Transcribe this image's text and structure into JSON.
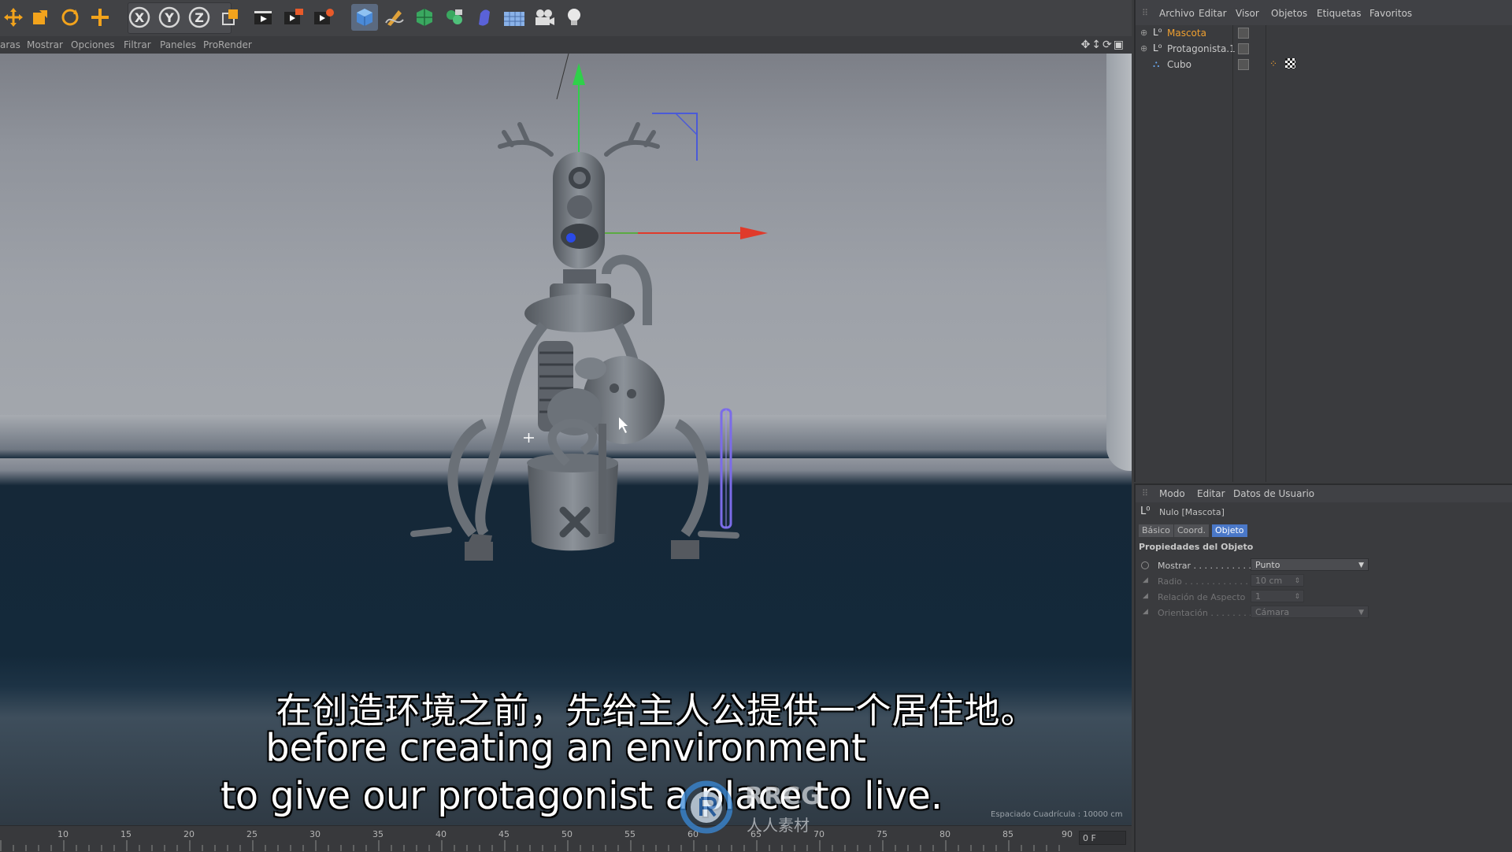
{
  "toolbar": {
    "icons": [
      "move-icon",
      "scale-icon",
      "rotate-icon",
      "create-icon",
      "x-axis-icon",
      "y-axis-icon",
      "z-axis-icon",
      "world-coordinate-icon",
      "render-view-icon",
      "render-picture-viewer-icon",
      "render-settings-icon",
      "cube-icon",
      "pen-icon",
      "subdivision-icon",
      "array-icon",
      "deformer-icon",
      "floor-icon",
      "camera-icon",
      "light-icon"
    ],
    "axis_labels": {
      "x": "X",
      "y": "Y",
      "z": "Z"
    }
  },
  "viewport_menu": [
    "aras",
    "Mostrar",
    "Opciones",
    "Filtrar",
    "Paneles",
    "ProRender"
  ],
  "viewport": {
    "grid_spacing_text": "Espaciado Cuadrícula : 10000 cm"
  },
  "object_manager": {
    "menu": [
      "Archivo",
      "Editar",
      "Visor",
      "Objetos",
      "Etiquetas",
      "Favoritos"
    ],
    "objects": [
      {
        "name": "Mascota",
        "selected": true
      },
      {
        "name": "Protagonista.1",
        "selected": false
      },
      {
        "name": "Cubo",
        "selected": false
      }
    ]
  },
  "attribute_manager": {
    "menu": [
      "Modo",
      "Editar",
      "Datos de Usuario"
    ],
    "object_title": "Nulo [Mascota]",
    "tabs": [
      "Básico",
      "Coord.",
      "Objeto"
    ],
    "active_tab": "Objeto",
    "section_title": "Propiedades del Objeto",
    "properties": [
      {
        "label": "Mostrar . . . . . . . . . . .",
        "value": "Punto",
        "enabled": true
      },
      {
        "label": "Radio . . . . . . . . . . . . .",
        "value": "10 cm",
        "enabled": false
      },
      {
        "label": "Relación de Aspecto",
        "value": "1",
        "enabled": false
      },
      {
        "label": "Orientación . . . . . . . .",
        "value": "Cámara",
        "enabled": false
      }
    ]
  },
  "timeline": {
    "ticks": [
      "10",
      "15",
      "20",
      "25",
      "30",
      "35",
      "40",
      "45",
      "50",
      "55",
      "60",
      "65",
      "70",
      "75",
      "80",
      "85",
      "90"
    ],
    "current_frame": "0 F"
  },
  "subtitles": {
    "chinese": "在创造环境之前，先给主人公提供一个居住地。",
    "english_line1": "before creating an environment",
    "english_line2": "to give our protagonist a place to live."
  },
  "watermark": {
    "text": "RRCG",
    "subtext": "人人素材"
  },
  "colors": {
    "accent_selected": "#f0a030",
    "active_tab": "#4a78c8",
    "x_axis": "#e03a2a",
    "y_axis": "#2fd04a",
    "z_axis": "#2a4ae8"
  }
}
